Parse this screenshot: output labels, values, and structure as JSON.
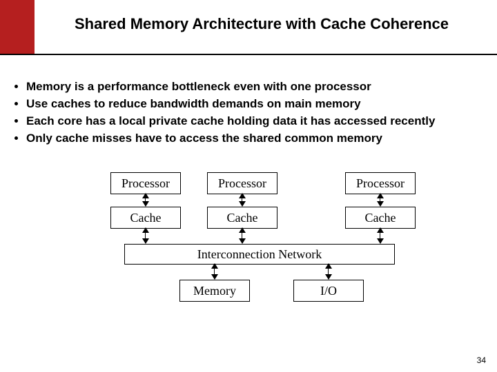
{
  "title": "Shared Memory Architecture with Cache Coherence",
  "bullets": [
    "Memory is a performance bottleneck even with one processor",
    "Use caches to reduce bandwidth demands on main memory",
    "Each core has a local private cache holding data it has accessed recently",
    "Only cache misses have to access the shared common memory"
  ],
  "diagram": {
    "processor": "Processor",
    "cache": "Cache",
    "network": "Interconnection Network",
    "memory": "Memory",
    "io": "I/O"
  },
  "page": "34"
}
